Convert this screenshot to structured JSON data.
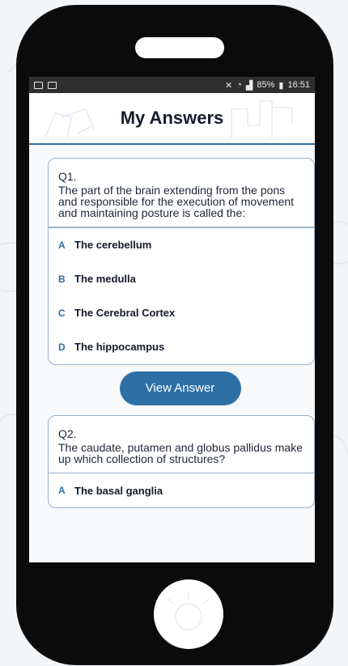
{
  "status": {
    "battery_text": "85%",
    "time": "16:51"
  },
  "header": {
    "title": "My Answers"
  },
  "questions": [
    {
      "number": "Q1.",
      "text": "The part of the brain extending from the pons and responsible for the execution of movement and maintaining posture is called the:",
      "answers": [
        {
          "letter": "A",
          "text": "The cerebellum"
        },
        {
          "letter": "B",
          "text": "The medulla"
        },
        {
          "letter": "C",
          "text": "The Cerebral Cortex"
        },
        {
          "letter": "D",
          "text": "The hippocampus"
        }
      ],
      "button": "View Answer"
    },
    {
      "number": "Q2.",
      "text": "The caudate, putamen and globus pallidus make up which collection of structures?",
      "answers": [
        {
          "letter": "A",
          "text": "The basal ganglia"
        }
      ]
    }
  ],
  "colors": {
    "accent": "#2e6da4",
    "card_border": "#9bb2c8",
    "phone": "#0b0b0b"
  }
}
